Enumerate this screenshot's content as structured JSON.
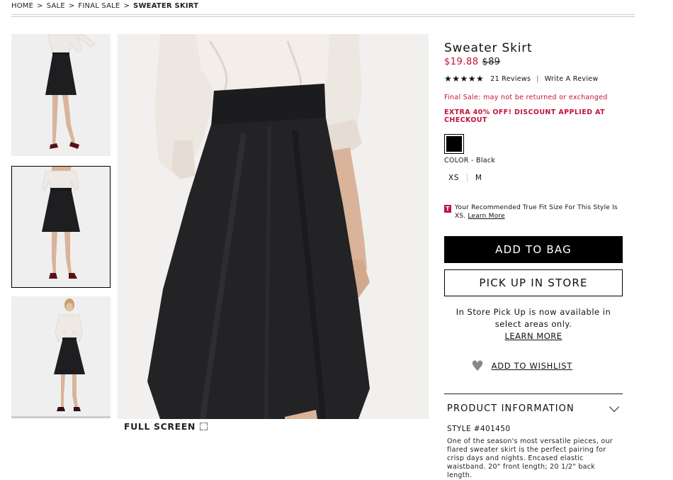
{
  "breadcrumb": [
    "HOME",
    "SALE",
    "FINAL SALE",
    "SWEATER SKIRT"
  ],
  "breadcrumb_sep": ">",
  "product": {
    "title": "Sweater Skirt",
    "sale_price": "$19.88",
    "original_price": "$89",
    "stars": "★★★★★",
    "rating": 5,
    "review_count": "21 Reviews",
    "write_review": "Write A Review",
    "final_sale_note": "Final Sale: may not be returned or exchanged",
    "extra_off": "EXTRA 40% OFF! DISCOUNT APPLIED AT CHECKOUT",
    "color_label": "COLOR - Black",
    "swatch_color": "#000000",
    "sizes": [
      "XS",
      "M"
    ],
    "truefit_logo": "T",
    "truefit_text": "Your Recommended True Fit Size For This Style Is XS.",
    "truefit_link": "Learn More"
  },
  "actions": {
    "add_to_bag": "ADD TO BAG",
    "pick_up": "PICK UP IN STORE",
    "pickup_note": "In Store Pick Up is now available in select areas only.",
    "learn_more": "LEARN MORE",
    "wishlist": "ADD TO WISHLIST",
    "heart_icon": "heart-icon"
  },
  "gallery": {
    "fullscreen_label": "FULL SCREEN",
    "fullscreen_icon": "expand-icon"
  },
  "info_panel": {
    "heading": "PRODUCT INFORMATION",
    "style": "STYLE #401450",
    "description": "One of the season's most versatile pieces, our flared sweater skirt is the perfect pairing for crisp days and nights. Encased elastic waistband. 20\" front length; 20 1/2\" back length."
  },
  "colors": {
    "accent": "#c0143c",
    "button": "#000000"
  }
}
